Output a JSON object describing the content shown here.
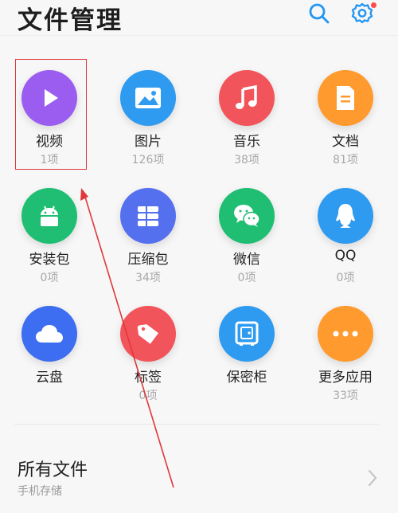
{
  "header": {
    "title": "文件管理",
    "icons": [
      "search-icon",
      "gear-icon"
    ],
    "accent_color": "#2196f3"
  },
  "categories": [
    {
      "label": "视频",
      "count": "1项",
      "icon": "play-icon",
      "color": "#9b5df0"
    },
    {
      "label": "图片",
      "count": "126项",
      "icon": "image-icon",
      "color": "#2e9bf0"
    },
    {
      "label": "音乐",
      "count": "38项",
      "icon": "music-note-icon",
      "color": "#f2545b"
    },
    {
      "label": "文档",
      "count": "81项",
      "icon": "document-icon",
      "color": "#ff9a2f"
    },
    {
      "label": "安装包",
      "count": "0项",
      "icon": "android-icon",
      "color": "#1fbe72"
    },
    {
      "label": "压缩包",
      "count": "34项",
      "icon": "archive-icon",
      "color": "#5570ef"
    },
    {
      "label": "微信",
      "count": "0项",
      "icon": "wechat-icon",
      "color": "#1fbe72"
    },
    {
      "label": "QQ",
      "count": "0项",
      "icon": "qq-penguin-icon",
      "color": "#2e9bf0"
    },
    {
      "label": "云盘",
      "count": "",
      "icon": "cloud-icon",
      "color": "#3d6df0"
    },
    {
      "label": "标签",
      "count": "0项",
      "icon": "tag-icon",
      "color": "#f2545b"
    },
    {
      "label": "保密柜",
      "count": "",
      "icon": "safe-icon",
      "color": "#2e9bf0"
    },
    {
      "label": "更多应用",
      "count": "33项",
      "icon": "more-dots-icon",
      "color": "#ff9a2f"
    }
  ],
  "all_files": {
    "title": "所有文件",
    "subtitle": "手机存储",
    "icon": "chevron-right-icon"
  },
  "annotation": {
    "highlight_color": "#e0383b"
  }
}
